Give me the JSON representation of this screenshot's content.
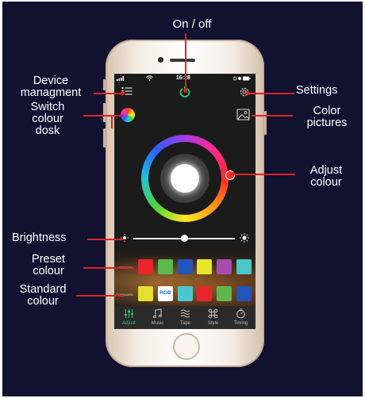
{
  "callouts": {
    "on_off": "On / off",
    "device_management": [
      "Device",
      "managment"
    ],
    "settings": "Settings",
    "switch_colour_disk": [
      "Switch",
      "colour",
      "dosk"
    ],
    "color_pictures": [
      "Color",
      "pictures"
    ],
    "adjust_colour": [
      "Adjust",
      "colour"
    ],
    "brightness": "Brightness",
    "preset_colour": [
      "Preset",
      "colour"
    ],
    "standard_colour": [
      "Standard",
      "colour"
    ]
  },
  "app": {
    "status_time": "16:28",
    "header_icons": [
      "list-menu-icon",
      "power-icon",
      "gear-icon"
    ],
    "wheel_icon": "color-wheel-icon",
    "picture_icon": "image-icon",
    "brightness_icons": [
      "sun-low-icon",
      "sun-high-icon"
    ],
    "brightness_level": 0.5,
    "accent_color": "#2ecc71",
    "preset_label": "PRESET",
    "preset_colors": [
      "#e8262a",
      "#5cb84a",
      "#2454b8",
      "#e8e62a",
      "#a64cb0",
      "#4cc6c8"
    ],
    "standard_label": "STANDARD",
    "standard_swatches": [
      {
        "color": "#e6de30",
        "text": ""
      },
      {
        "color": "#ffffff",
        "text": "RGB"
      },
      {
        "color": "#4cc6d0",
        "text": ""
      },
      {
        "color": "#e8262a",
        "text": ""
      },
      {
        "color": "#5cb84a",
        "text": ""
      },
      {
        "color": "#2454b8",
        "text": ""
      }
    ],
    "tabs": [
      {
        "label": "Adjust",
        "icon": "sliders-icon",
        "active": true
      },
      {
        "label": "Music",
        "icon": "music-note-icon",
        "active": false
      },
      {
        "label": "Tape",
        "icon": "wave-icon",
        "active": false
      },
      {
        "label": "Style",
        "icon": "command-icon",
        "active": false
      },
      {
        "label": "Timing",
        "icon": "timer-icon",
        "active": false
      }
    ]
  }
}
